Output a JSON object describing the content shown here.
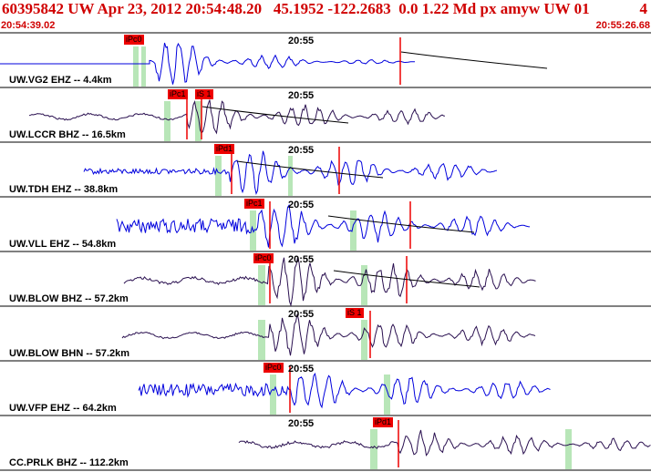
{
  "header": {
    "title": "60395842 UW Apr 23, 2012 20:54:48.20   45.1952 -122.2683  0.0 1.22 Md px amyw UW 01",
    "page_number": "4",
    "start_time": "20:54:39.02",
    "end_time": "20:55:26.68"
  },
  "colors": {
    "header_text": "#d00000",
    "pick": "#ee0000",
    "window": "#b8e6b8",
    "trace_blue": "#0000dd",
    "trace_purple": "#2a1050"
  },
  "panel_time_label": "20:55",
  "traces": [
    {
      "label": "UW.VG2 EHZ -- 4.4km",
      "color": "blue",
      "picks": [
        {
          "text": "iPc0"
        }
      ]
    },
    {
      "label": "UW.LCCR BHZ -- 16.5km",
      "color": "purple",
      "picks": [
        {
          "text": "iPc1"
        },
        {
          "text": "iS 1"
        }
      ]
    },
    {
      "label": "UW.TDH EHZ -- 38.8km",
      "color": "blue",
      "picks": [
        {
          "text": "iPd1"
        }
      ]
    },
    {
      "label": "UW.VLL EHZ -- 54.8km",
      "color": "blue",
      "picks": [
        {
          "text": "iPc1"
        }
      ]
    },
    {
      "label": "UW.BLOW BHZ -- 57.2km",
      "color": "purple",
      "picks": [
        {
          "text": "iPc0"
        }
      ]
    },
    {
      "label": "UW.BLOW BHN -- 57.2km",
      "color": "purple",
      "picks": [
        {
          "text": "iS 1"
        }
      ]
    },
    {
      "label": "UW.VFP EHZ -- 64.2km",
      "color": "blue",
      "picks": [
        {
          "text": "iPc0"
        }
      ]
    },
    {
      "label": "CC.PRLK BHZ -- 112.2km",
      "color": "purple",
      "picks": [
        {
          "text": "iPd1"
        }
      ]
    }
  ]
}
